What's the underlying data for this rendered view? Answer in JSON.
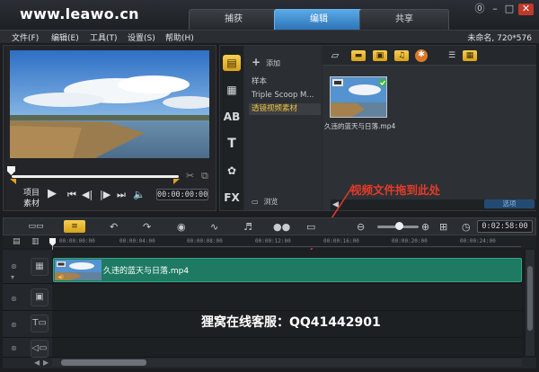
{
  "watermark": "www.leawo.cn",
  "tabs": [
    {
      "label": "捕获"
    },
    {
      "label": "编辑"
    },
    {
      "label": "共享"
    }
  ],
  "menu": {
    "items": [
      "文件(F)",
      "编辑(E)",
      "工具(T)",
      "设置(S)",
      "帮助(H)"
    ],
    "project_info": "未命名, 720*576"
  },
  "player": {
    "mode_project": "项目",
    "mode_clip": "素材",
    "timecode": "00:00:00:00"
  },
  "library": {
    "add_label": "添加",
    "folders": [
      "样本",
      "Triple Scoop M...",
      "透镜视频素材"
    ],
    "browse_label": "浏览",
    "clip_filename": "久违的蓝天与日落.mp4",
    "options_label": "选项"
  },
  "annotation": "视频文件拖到此处",
  "timeline": {
    "duration": "0:02:58:00",
    "ruler_labels": [
      "00:00:00:00",
      "00:00:04:00",
      "00:00:08:00",
      "00:00:12:00",
      "00:00:16:00",
      "00:00:20:00",
      "00:00:24:00"
    ],
    "clip_name": "久违的蓝天与日落.mp4"
  },
  "support_text": "狸窝在线客服：QQ41442901",
  "colors": {
    "accent_yellow": "#f0c23a",
    "tab_active": "#3c8fd6",
    "clip_green": "#1e7a63",
    "annotation_red": "#e53a2a"
  }
}
